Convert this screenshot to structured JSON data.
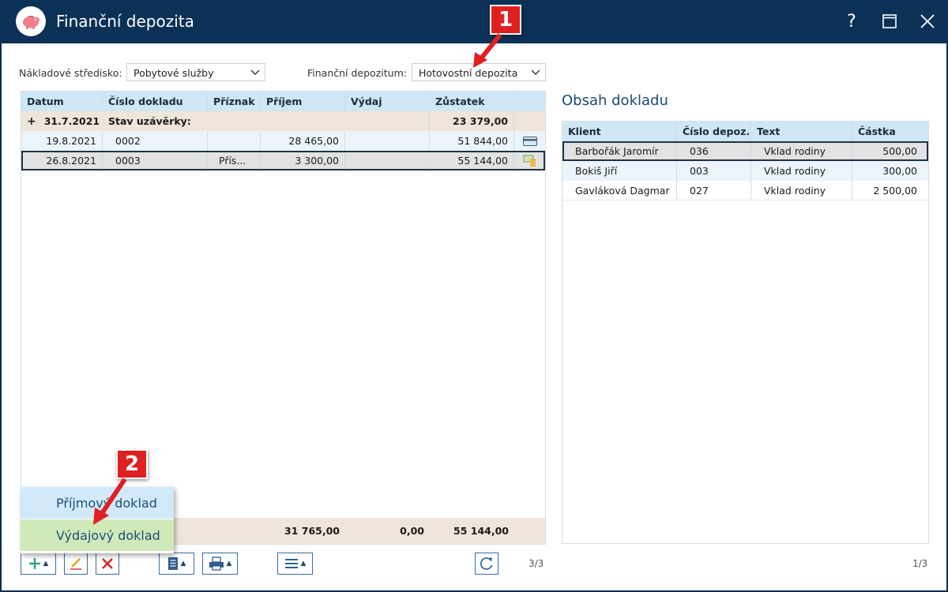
{
  "window": {
    "title": "Finanční depozita",
    "help_symbol": "?",
    "icon": "piggy-bank-icon"
  },
  "filters": {
    "cost_center_label": "Nákladové středisko:",
    "cost_center_value": "Pobytové služby",
    "deposit_label": "Finanční depozitum:",
    "deposit_value": "Hotovostní depozita"
  },
  "left_grid": {
    "columns": [
      "Datum",
      "Číslo dokladu",
      "Příznak",
      "Příjem",
      "Výdaj",
      "Zůstatek"
    ],
    "group_row": {
      "expander": "+",
      "date": "31.7.2021",
      "label": "Stav uzávěrky:",
      "balance": "23 379,00"
    },
    "rows": [
      {
        "date": "19.8.2021",
        "doc": "0002",
        "flag": "",
        "income": "28 465,00",
        "expense": "",
        "balance": "51 844,00",
        "icon": "card-icon"
      },
      {
        "date": "26.8.2021",
        "doc": "0003",
        "flag": "Přís...",
        "income": "3 300,00",
        "expense": "",
        "balance": "55 144,00",
        "icon": "cash-icon"
      }
    ],
    "footer": {
      "income": "31 765,00",
      "expense": "0,00",
      "balance": "55 144,00"
    },
    "pager": "3/3"
  },
  "right_panel": {
    "title": "Obsah dokladu",
    "columns": [
      "Klient",
      "Číslo depoz...",
      "Text",
      "Částka"
    ],
    "rows": [
      {
        "client": "Barbořák Jaromír",
        "number": "036",
        "text": "Vklad rodiny",
        "amount": "500,00"
      },
      {
        "client": "Bokiš Jiří",
        "number": "003",
        "text": "Vklad rodiny",
        "amount": "300,00"
      },
      {
        "client": "Gavláková Dagmar",
        "number": "027",
        "text": "Vklad rodiny",
        "amount": "2 500,00"
      }
    ],
    "pager": "1/3"
  },
  "popup_menu": {
    "items": [
      "Příjmový doklad",
      "Výdajový doklad"
    ]
  },
  "callouts": {
    "one": "1",
    "two": "2"
  },
  "colors": {
    "titlebar": "#0c3156",
    "header": "#cfe6f5",
    "group": "#efe5da",
    "callout": "#e02020",
    "accent": "#1b4a73"
  }
}
